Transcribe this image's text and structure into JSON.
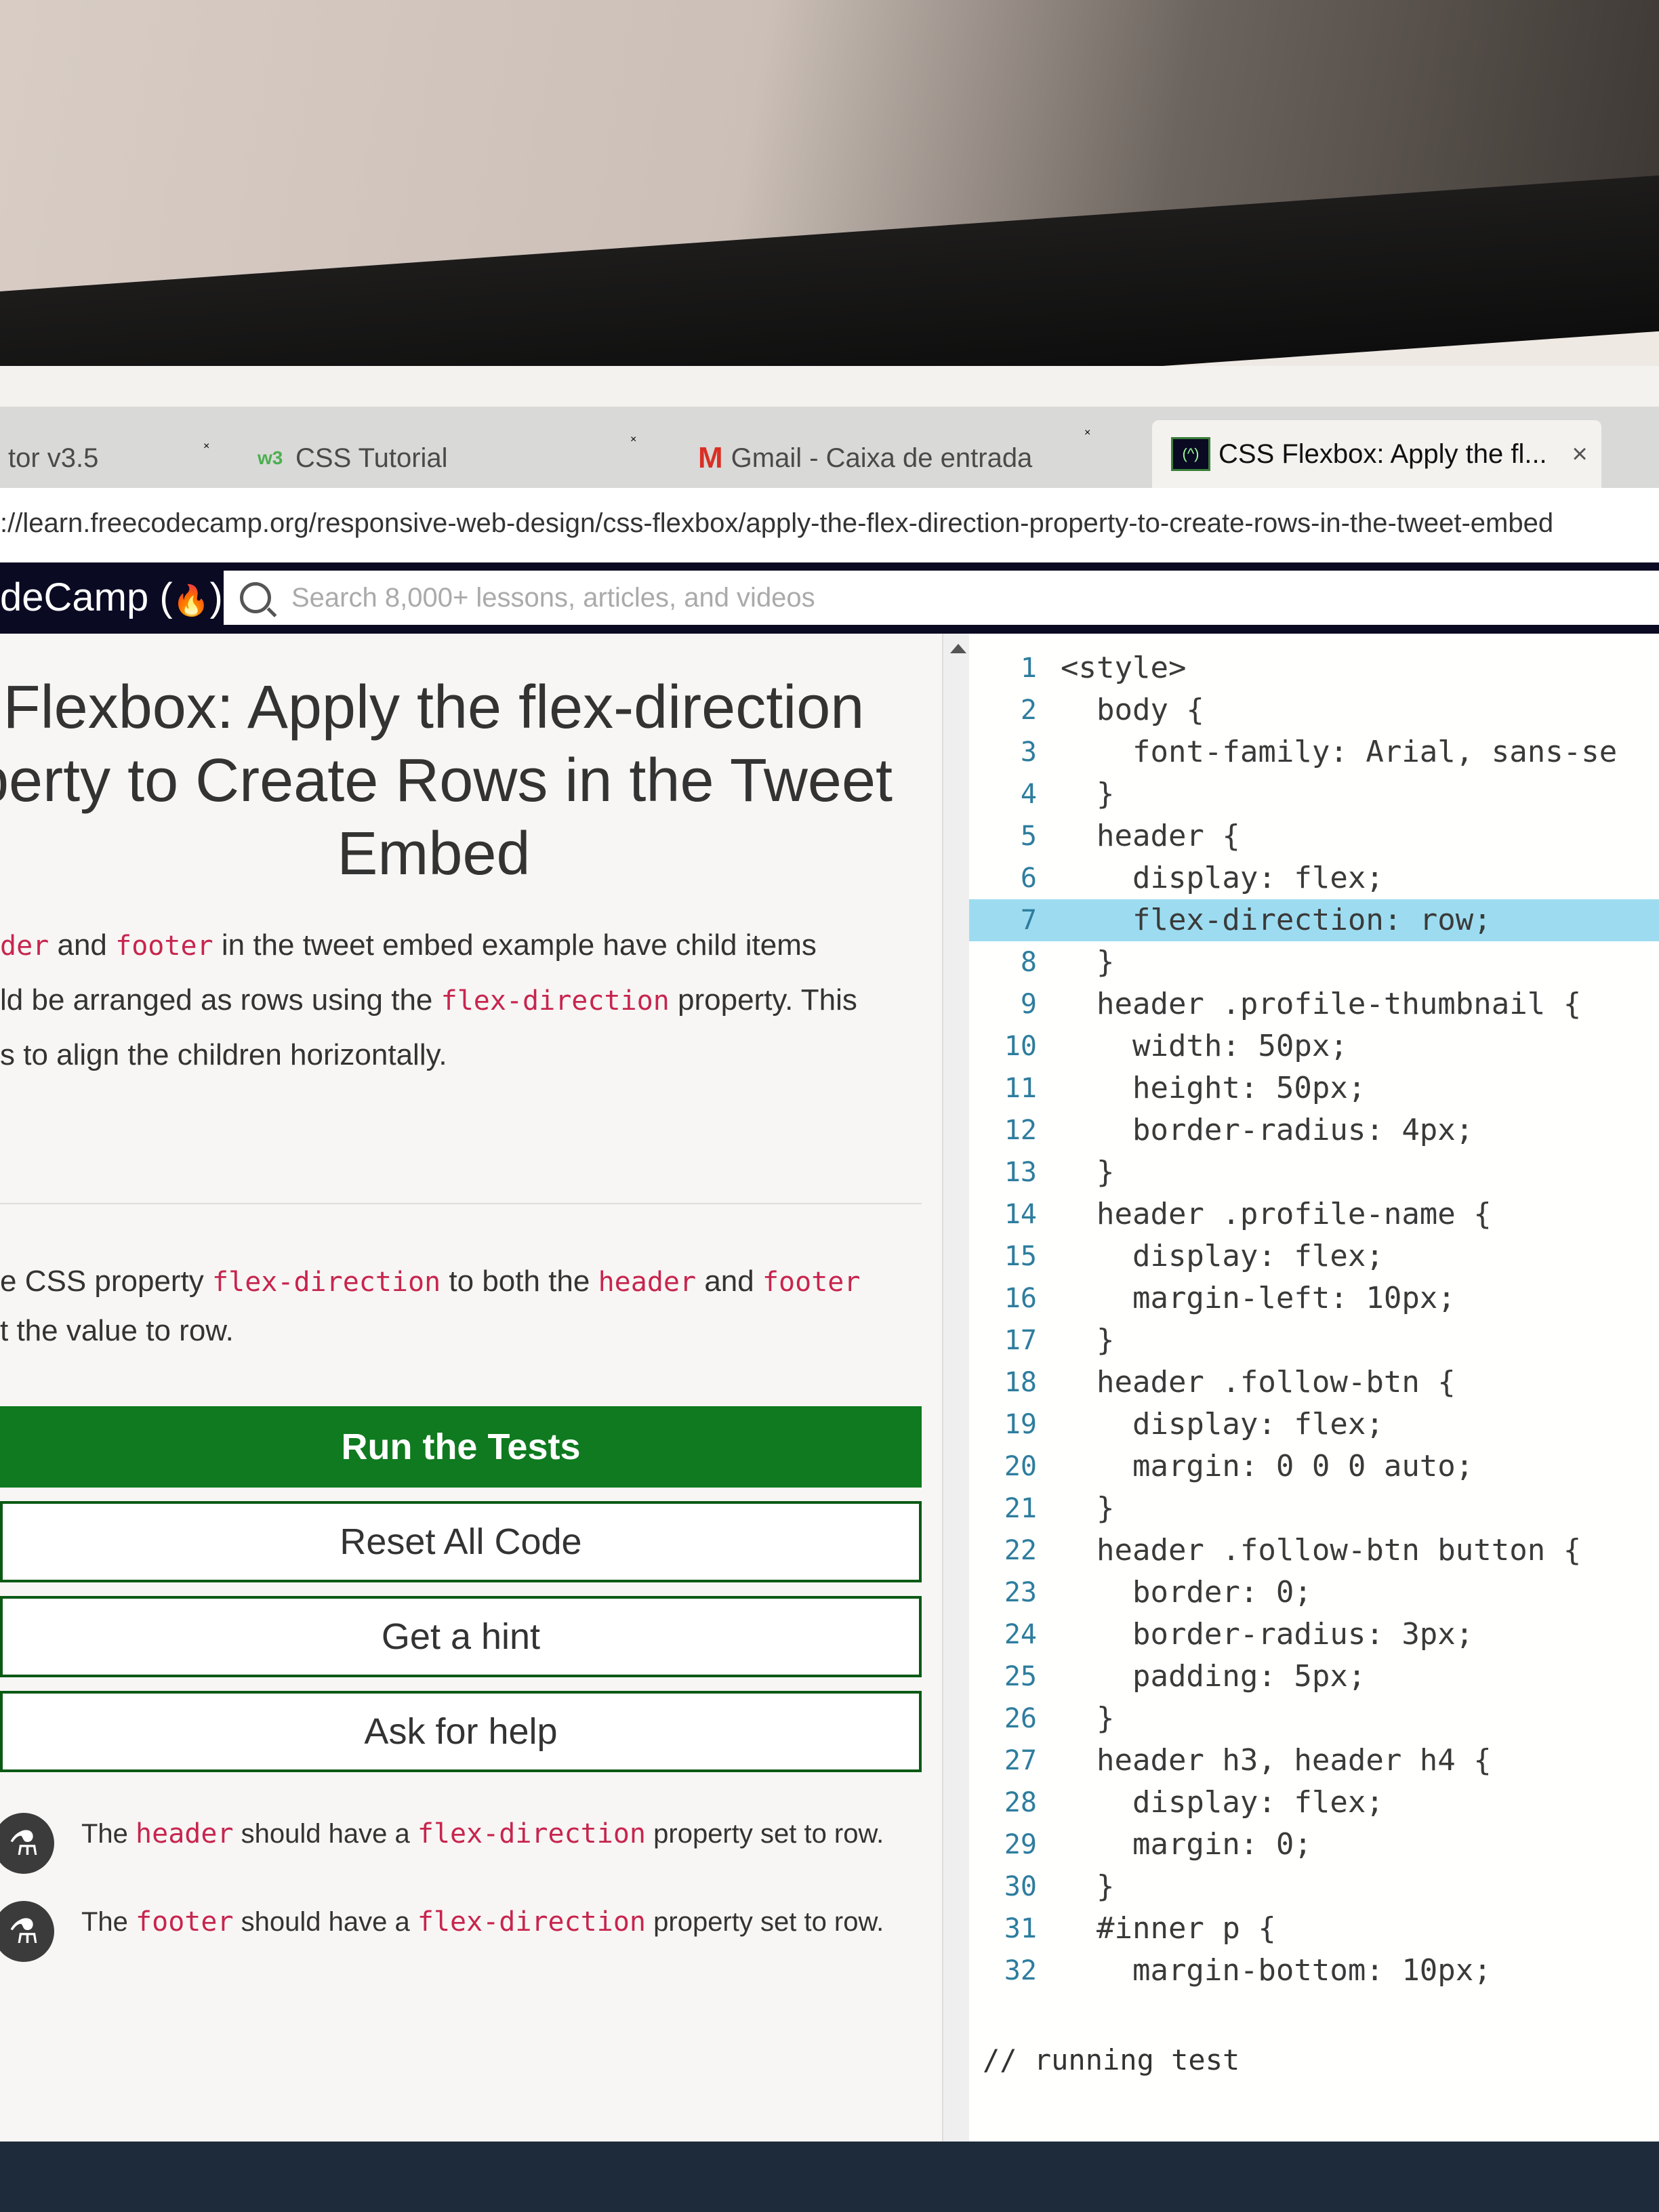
{
  "browser": {
    "tabs": [
      {
        "label": "tor v3.5",
        "icon": "",
        "active": false
      },
      {
        "label": "CSS Tutorial",
        "icon": "w3-icon",
        "active": false
      },
      {
        "label": "Gmail - Caixa de entrada",
        "icon": "gmail-icon",
        "active": false
      },
      {
        "label": "CSS Flexbox: Apply the fl...",
        "icon": "freecodecamp-icon",
        "active": true
      }
    ],
    "close_glyph": "×",
    "address": "://learn.freecodecamp.org/responsive-web-design/css-flexbox/apply-the-flex-direction-property-to-create-rows-in-the-tweet-embed"
  },
  "nav": {
    "brand": "deCamp (",
    "brand_icon": "flame-icon",
    "brand_end": ")",
    "search_placeholder": "Search 8,000+ lessons, articles, and videos"
  },
  "lesson": {
    "title": "Flexbox: Apply the flex-direction perty to Create Rows in the Tweet Embed",
    "description": {
      "code1": "der",
      "t1": " and ",
      "code2": "footer",
      "t2": " in the tweet embed example have child items",
      "t3": "ld be arranged as rows using the ",
      "code3": "flex-direction",
      "t4": " property. This",
      "t5": "s to align the children horizontally."
    },
    "instructions": {
      "t1": "e CSS property ",
      "code1": "flex-direction",
      "t2": " to both the ",
      "code2": "header",
      "t3": " and ",
      "code3": "footer",
      "t4": "t the value to row."
    }
  },
  "buttons": {
    "run": "Run the Tests",
    "reset": "Reset All Code",
    "hint": "Get a hint",
    "help": "Ask for help"
  },
  "tests": [
    {
      "pre": "The ",
      "code1": "header",
      "mid": " should have a ",
      "code2": "flex-direction",
      "post": " property set to row."
    },
    {
      "pre": "The ",
      "code1": "footer",
      "mid": " should have a ",
      "code2": "flex-direction",
      "post": " property set to row."
    }
  ],
  "editor": {
    "lines": [
      {
        "n": "1",
        "text": "<style>"
      },
      {
        "n": "2",
        "text": "  body {"
      },
      {
        "n": "3",
        "text": "    font-family: Arial, sans-se"
      },
      {
        "n": "4",
        "text": "  }"
      },
      {
        "n": "5",
        "text": "  header {"
      },
      {
        "n": "6",
        "text": "    display: flex;"
      },
      {
        "n": "7",
        "text": "    flex-direction: row;"
      },
      {
        "n": "8",
        "text": "  }"
      },
      {
        "n": "9",
        "text": "  header .profile-thumbnail {"
      },
      {
        "n": "10",
        "text": "    width: 50px;"
      },
      {
        "n": "11",
        "text": "    height: 50px;"
      },
      {
        "n": "12",
        "text": "    border-radius: 4px;"
      },
      {
        "n": "13",
        "text": "  }"
      },
      {
        "n": "14",
        "text": "  header .profile-name {"
      },
      {
        "n": "15",
        "text": "    display: flex;"
      },
      {
        "n": "16",
        "text": "    margin-left: 10px;"
      },
      {
        "n": "17",
        "text": "  }"
      },
      {
        "n": "18",
        "text": "  header .follow-btn {"
      },
      {
        "n": "19",
        "text": "    display: flex;"
      },
      {
        "n": "20",
        "text": "    margin: 0 0 0 auto;"
      },
      {
        "n": "21",
        "text": "  }"
      },
      {
        "n": "22",
        "text": "  header .follow-btn button {"
      },
      {
        "n": "23",
        "text": "    border: 0;"
      },
      {
        "n": "24",
        "text": "    border-radius: 3px;"
      },
      {
        "n": "25",
        "text": "    padding: 5px;"
      },
      {
        "n": "26",
        "text": "  }"
      },
      {
        "n": "27",
        "text": "  header h3, header h4 {"
      },
      {
        "n": "28",
        "text": "    display: flex;"
      },
      {
        "n": "29",
        "text": "    margin: 0;"
      },
      {
        "n": "30",
        "text": "  }"
      },
      {
        "n": "31",
        "text": "  #inner p {"
      },
      {
        "n": "32",
        "text": "    margin-bottom: 10px;"
      }
    ],
    "highlighted_line": "7",
    "status": "// running test"
  }
}
